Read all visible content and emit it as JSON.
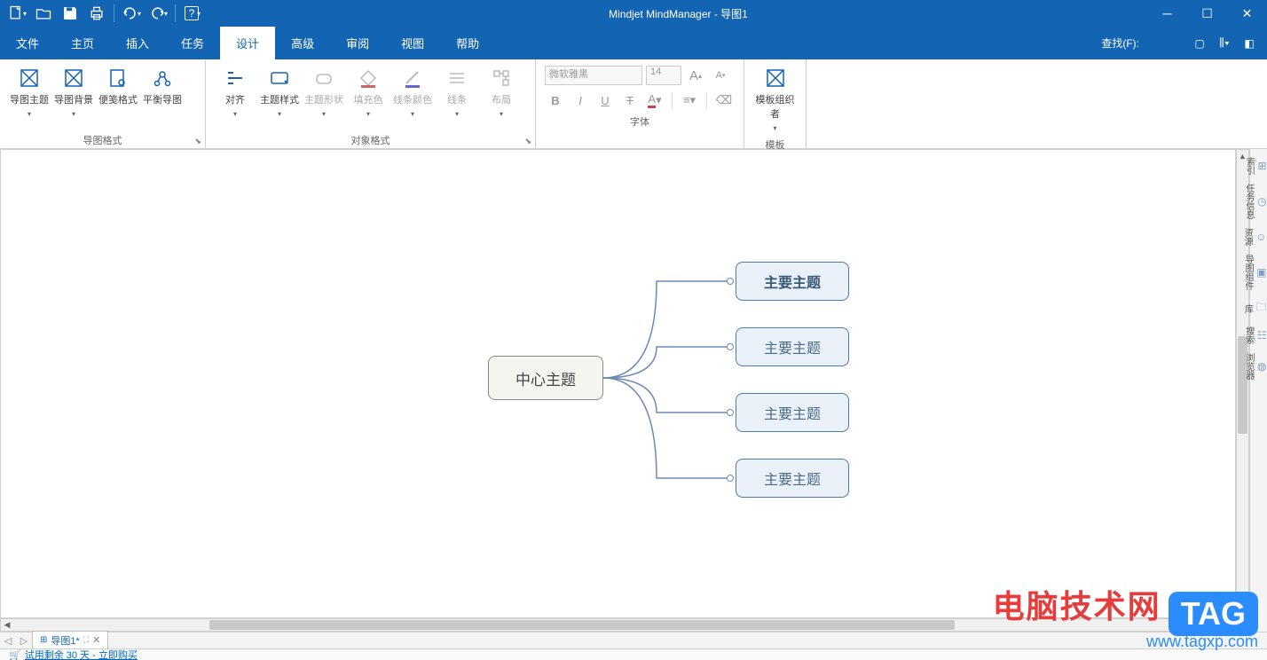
{
  "app_title": "Mindjet MindManager - 导图1",
  "qat": {
    "new": "new",
    "open": "open",
    "save": "save",
    "print": "print",
    "undo": "undo",
    "redo": "redo",
    "help": "help"
  },
  "tabs": [
    "文件",
    "主页",
    "插入",
    "任务",
    "设计",
    "高级",
    "审阅",
    "视图",
    "帮助"
  ],
  "active_tab": "设计",
  "search_label": "查找(F):",
  "ribbon": {
    "g1": {
      "label": "导图格式",
      "btns": {
        "theme": "导图主题",
        "bg": "导图背景",
        "quick": "便笺格式",
        "balance": "平衡导图"
      }
    },
    "g2": {
      "label": "对象格式",
      "btns": {
        "align": "对齐",
        "style": "主题样式",
        "shape": "主题形状",
        "fill": "填充色",
        "line_color": "线条颜色",
        "lines": "线条",
        "layout": "布局"
      }
    },
    "g3": {
      "label": "字体",
      "font_name": "微软雅黑",
      "font_size": "14"
    },
    "g4": {
      "label": "模板",
      "btn": "模板组织者"
    }
  },
  "map": {
    "central": "中心主题",
    "topics": [
      "主要主题",
      "主要主题",
      "主要主题",
      "主要主题"
    ]
  },
  "side_tabs": [
    "索引",
    "任务信息",
    "资源",
    "导图组件",
    "库",
    "搜索",
    "浏览器"
  ],
  "doc_tab": "导图1*",
  "trial": "试用剩余 30 天 - 立即购买",
  "watermark": {
    "text": "电脑技术网",
    "tag": "TAG",
    "url": "www.tagxp.com"
  }
}
